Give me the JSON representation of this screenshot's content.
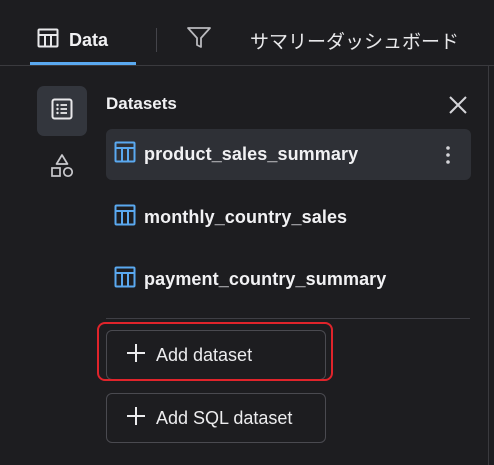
{
  "tabs": {
    "data_label": "Data",
    "summary_label": "サマリーダッシュボード"
  },
  "panel": {
    "title": "Datasets"
  },
  "datasets": [
    {
      "name": "product_sales_summary",
      "selected": true
    },
    {
      "name": "monthly_country_sales",
      "selected": false
    },
    {
      "name": "payment_country_summary",
      "selected": false
    }
  ],
  "actions": {
    "add_dataset": "Add dataset",
    "add_sql_dataset": "Add SQL dataset"
  },
  "colors": {
    "accent": "#5aa9f0",
    "highlight": "#e0242b",
    "background": "#1d1d20"
  },
  "icons": {
    "data_tab": "table-icon",
    "filter_tab": "filter-icon",
    "rail_datasets": "list-icon",
    "rail_shapes": "shapes-icon",
    "dataset": "table-icon",
    "close": "close-icon",
    "more": "kebab-icon",
    "add": "plus-icon"
  }
}
